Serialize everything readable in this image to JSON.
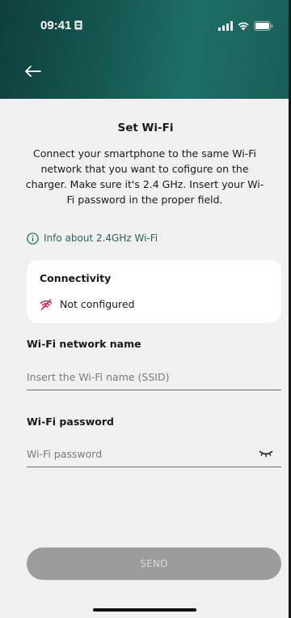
{
  "status_bar": {
    "time": "09:41"
  },
  "header": {
    "back_icon": "arrow-left-icon"
  },
  "page": {
    "title": "Set Wi-Fi",
    "description": "Connect your smartphone to the same Wi-Fi network that you want to cofigure on the charger. Make sure it's 2.4 GHz. Insert your Wi-Fi password in the proper field.",
    "info_link": "Info about 2.4GHz Wi-Fi"
  },
  "connectivity": {
    "title": "Connectivity",
    "status": "Not configured",
    "status_color": "#d8263a"
  },
  "form": {
    "ssid_label": "Wi-Fi network name",
    "ssid_placeholder": "Insert the Wi-Fi name (SSID)",
    "ssid_value": "",
    "password_label": "Wi-Fi password",
    "password_placeholder": "Wi-Fi password",
    "password_value": ""
  },
  "actions": {
    "send_label": "SEND"
  },
  "colors": {
    "accent": "#1b6b63",
    "header_dark": "#0f3f3c",
    "button_disabled": "#9c9c9c"
  }
}
